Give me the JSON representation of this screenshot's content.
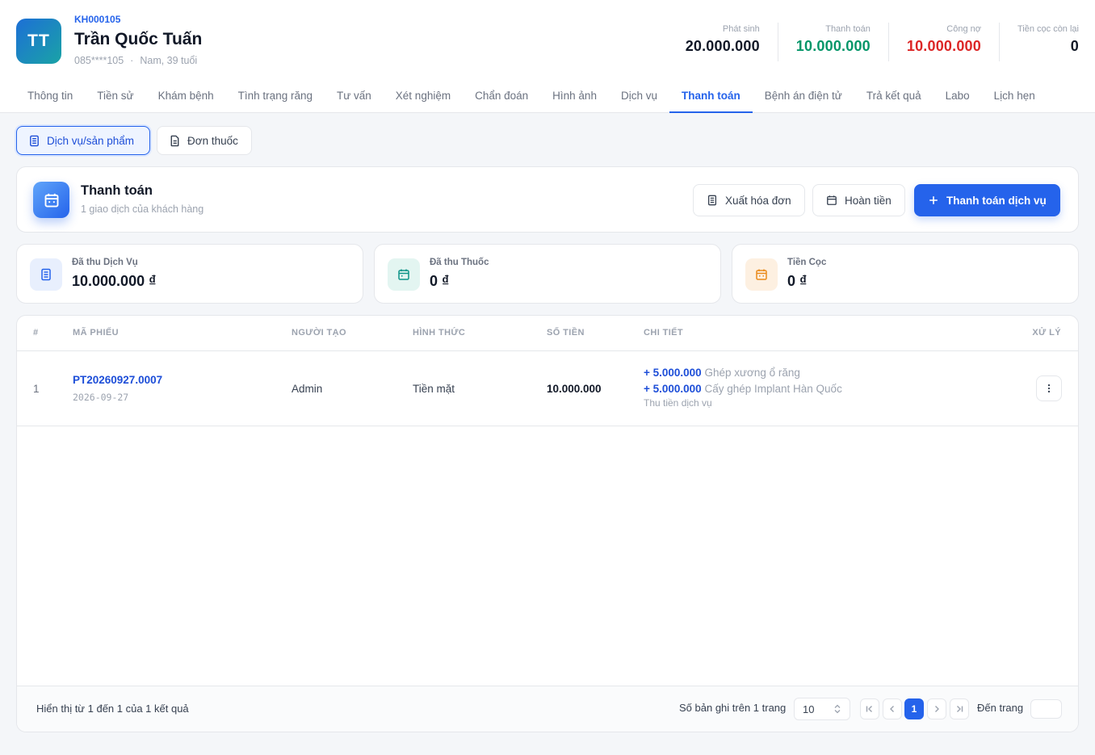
{
  "customer": {
    "initials": "TT",
    "code": "KH000105",
    "name": "Trần Quốc Tuấn",
    "phone": "085****105",
    "separator": "·",
    "info": "Nam, 39 tuổi"
  },
  "stats": [
    {
      "label": "Phát sinh",
      "value": "20.000.000",
      "color": "#111827"
    },
    {
      "label": "Thanh toán",
      "value": "10.000.000",
      "color": "#059669"
    },
    {
      "label": "Công nợ",
      "value": "10.000.000",
      "color": "#dc2626"
    },
    {
      "label": "Tiền cọc còn lại",
      "value": "0",
      "color": "#111827"
    }
  ],
  "tabs": [
    "Thông tin",
    "Tiền sử",
    "Khám bệnh",
    "Tình trạng răng",
    "Tư vấn",
    "Xét nghiệm",
    "Chẩn đoán",
    "Hình ảnh",
    "Dịch vụ",
    "Thanh toán",
    "Bệnh án điện tử",
    "Trả kết quả",
    "Labo",
    "Lịch hẹn"
  ],
  "active_tab": "Thanh toán",
  "subtabs": {
    "services": "Dịch vụ/sản phẩm",
    "prescription": "Đơn thuốc"
  },
  "payment": {
    "title": "Thanh toán",
    "subtitle": "1 giao dịch của khách hàng",
    "btn_invoice": "Xuất hóa đơn",
    "btn_refund": "Hoàn tiền",
    "btn_pay": "Thanh toán dịch vụ"
  },
  "summary": [
    {
      "label": "Đã thu Dịch Vụ",
      "value": "10.000.000 ₫",
      "icon": "document-icon",
      "bg": "#e8effd",
      "fg": "#2563eb"
    },
    {
      "label": "Đã thu Thuốc",
      "value": "0 ₫",
      "icon": "calendar-icon",
      "bg": "#e3f5f1",
      "fg": "#0d9488"
    },
    {
      "label": "Tiền Cọc",
      "value": "0 ₫",
      "icon": "calendar-icon",
      "bg": "#fdf0e1",
      "fg": "#ea8a1a"
    }
  ],
  "table": {
    "headers": {
      "index": "#",
      "code": "MÃ PHIẾU",
      "creator": "NGƯỜI TẠO",
      "method": "HÌNH THỨC",
      "amount": "SỐ TIỀN",
      "detail": "CHI TIẾT",
      "action": "XỬ LÝ"
    },
    "rows": [
      {
        "index": "1",
        "code": "PT20260927.0007",
        "date": "2026-09-27",
        "creator": "Admin",
        "method": "Tiền mặt",
        "amount": "10.000.000",
        "details": [
          {
            "amount": "+ 5.000.000",
            "text": "Ghép xương ổ răng"
          },
          {
            "amount": "+ 5.000.000",
            "text": "Cấy ghép Implant Hàn Quốc"
          }
        ],
        "note": "Thu tiền dịch vụ"
      }
    ]
  },
  "pagination": {
    "summary": "Hiển thị từ 1 đến 1 của 1 kết quả",
    "per_page_label": "Số bản ghi trên 1 trang",
    "per_page": "10",
    "current_page": "1",
    "goto_label": "Đến trang",
    "goto_value": ""
  }
}
